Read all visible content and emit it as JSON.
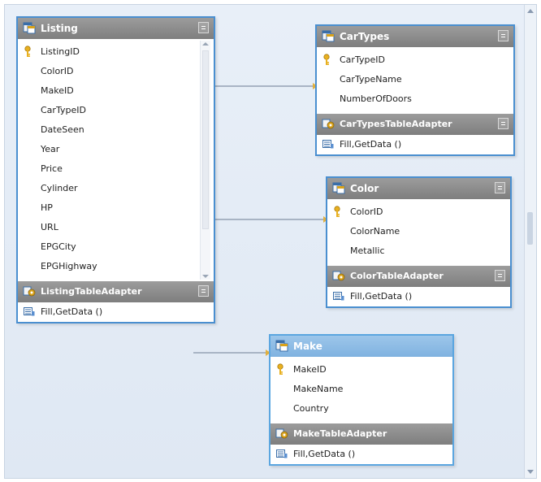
{
  "tables": {
    "listing": {
      "title": "Listing",
      "columns": [
        "ListingID",
        "ColorID",
        "MakeID",
        "CarTypeID",
        "DateSeen",
        "Year",
        "Price",
        "Cylinder",
        "HP",
        "URL",
        "EPGCity",
        "EPGHighway"
      ],
      "adapter": "ListingTableAdapter",
      "method": "Fill,GetData ()"
    },
    "cartypes": {
      "title": "CarTypes",
      "columns": [
        "CarTypeID",
        "CarTypeName",
        "NumberOfDoors"
      ],
      "adapter": "CarTypesTableAdapter",
      "method": "Fill,GetData ()"
    },
    "color": {
      "title": "Color",
      "columns": [
        "ColorID",
        "ColorName",
        "Metallic"
      ],
      "adapter": "ColorTableAdapter",
      "method": "Fill,GetData ()"
    },
    "make": {
      "title": "Make",
      "columns": [
        "MakeID",
        "MakeName",
        "Country"
      ],
      "adapter": "MakeTableAdapter",
      "method": "Fill,GetData ()"
    }
  },
  "colors": {
    "table_border": "#4a8fd0",
    "header_gray": "#8a8a8a",
    "header_selected": "#8dbce6",
    "key_gold": "#e8b020",
    "canvas": "#e4ecf6"
  },
  "icons": {
    "table": "dataset-table-icon",
    "key": "primary-key-icon",
    "adapter": "table-adapter-icon",
    "method": "query-method-icon"
  }
}
